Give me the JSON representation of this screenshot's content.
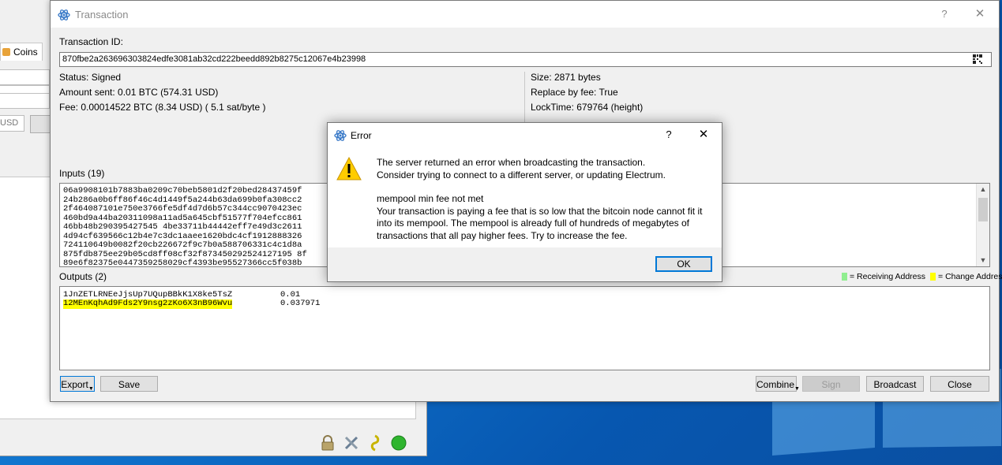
{
  "main_window": {
    "coins_tab": "Coins",
    "usd_label": "USD"
  },
  "tx_dialog": {
    "title": "Transaction",
    "help_btn": "?",
    "close_btn": "✕",
    "txid_label": "Transaction ID:",
    "txid": "870fbe2a263696303824edfe3081ab32cd222beedd892b8275c12067e4b23998",
    "status": "Status: Signed",
    "amount_sent": "Amount sent: 0.01 BTC (574.31 USD)",
    "fee": "Fee: 0.00014522 BTC (8.34 USD)  ( 5.1 sat/byte )",
    "size": "Size: 2871 bytes",
    "replace_by_fee": "Replace by fee: True",
    "locktime": "LockTime: 679764 (height)",
    "inputs_label": "Inputs (19)",
    "inputs": [
      "06a9908101b7883ba0209c70beb5801d2f20bed28437459f",
      "24b286a0b6ff86f46c4d1449f5a244b63da699b0fa308cc2",
      "2f464087101e750e3766fe5df4d7d6b57c344cc9070423ec",
      "460bd9a44ba20311098a11ad5a645cbf51577f704efcc861",
      "46bb48b290395427545 4be33711b44442eff7e49d3c2611",
      "4d94cf639566c12b4e7c3dc1aaee1620bdc4cf1912888326",
      "724110649b0082f20cb226672f9c7b0a588706331c4c1d8a",
      "875fdb875ee29b05cd8ff08cf32f873450292524127195 8f",
      "89e6f82375e0447359258029cf4393be95527366cc5f038b"
    ],
    "outputs_label": "Outputs (2)",
    "legend_receiving": "= Receiving Address",
    "legend_change": "= Change Address",
    "outputs": [
      {
        "address": "1JnZETLRNEeJjsUp7UQupBBkK1X8ke5TsZ",
        "amount": "0.01",
        "highlight": false
      },
      {
        "address": "12MEnKqhAd9Fds2Y9nsg2zKo6X3nB96Wvu",
        "amount": "0.037971",
        "highlight": true
      }
    ],
    "buttons": {
      "export": "Export",
      "save": "Save",
      "combine": "Combine",
      "sign": "Sign",
      "broadcast": "Broadcast",
      "close": "Close"
    },
    "colors": {
      "receiving": "#90ee90",
      "change": "#ffff00"
    }
  },
  "error_dialog": {
    "title": "Error",
    "help_btn": "?",
    "close_btn": "✕",
    "line1": "The server returned an error when broadcasting the transaction.",
    "line2": "Consider trying to connect to a different server, or updating Electrum.",
    "line3": "mempool min fee not met",
    "line4": "Your transaction is paying a fee that is so low that the bitcoin node cannot fit it",
    "line5": "into its mempool. The mempool is already full of hundreds of megabytes of",
    "line6": "transactions that all pay higher fees. Try to increase the fee.",
    "ok": "OK"
  }
}
